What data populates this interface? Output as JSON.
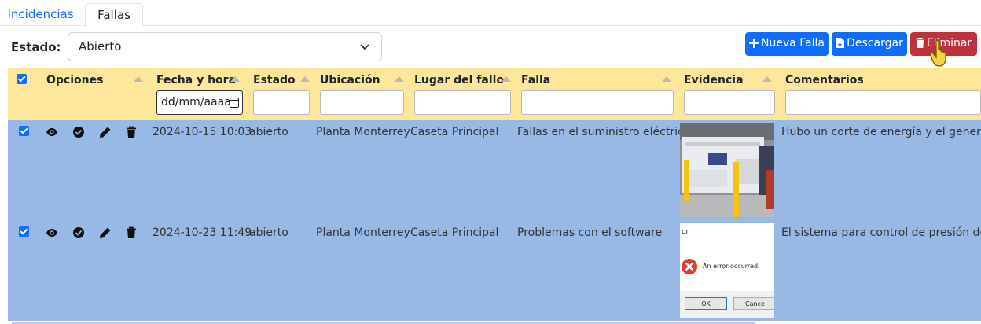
{
  "tabs": {
    "incidencias": "Incidencias",
    "fallas": "Fallas"
  },
  "filter": {
    "label": "Estado:",
    "value": "Abierto"
  },
  "buttons": {
    "nueva": "Nueva Falla",
    "descargar": "Descargar",
    "eliminar": "Eliminar"
  },
  "columns": {
    "opciones": "Opciones",
    "fecha": "Fecha y hora",
    "estado": "Estado",
    "ubicacion": "Ubicación",
    "lugar": "Lugar del fallo",
    "falla": "Falla",
    "evidencia": "Evidencia",
    "comentarios": "Comentarios"
  },
  "date_placeholder": "dd/mm/aaaa",
  "rows": [
    {
      "fecha": "2024-10-15 10:03",
      "estado": "abierto",
      "ubicacion": "Planta Monterrey",
      "lugar": "Caseta Principal",
      "falla": "Fallas en el suministro eléctrico",
      "comentarios": "Hubo un corte de energía y el generador"
    },
    {
      "fecha": "2024-10-23 11:49",
      "estado": "abierto",
      "ubicacion": "Planta Monterrey",
      "lugar": "Caseta Principal",
      "falla": "Problemas con el software",
      "comentarios": "El sistema para control de presión de m"
    }
  ],
  "error_dialog": {
    "title_fragment": "or",
    "message": "An error occurred.",
    "ok": "OK",
    "cancel": "Cance"
  },
  "colors": {
    "header": "#fee69a",
    "row": "#98b8e6",
    "primary": "#0d6efd",
    "danger": "#c0313e"
  }
}
